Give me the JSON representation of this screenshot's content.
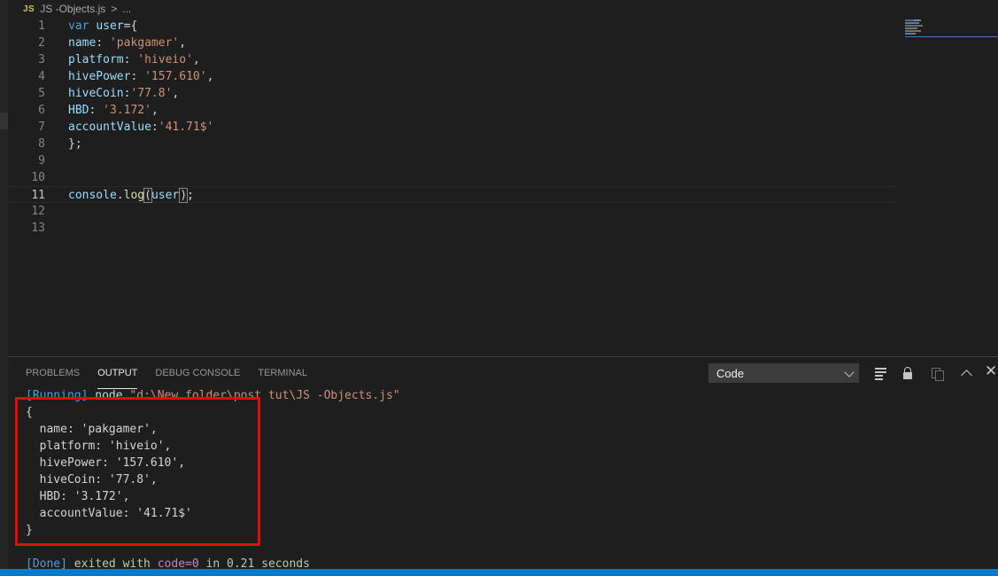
{
  "breadcrumb": {
    "file_icon": "JS",
    "file": "JS -Objects.js",
    "separator": ">",
    "trail": "..."
  },
  "editor": {
    "lines": [
      {
        "n": "1",
        "parts": [
          {
            "t": "var",
            "c": "t-var"
          },
          {
            "t": " ",
            "c": "t-plain"
          },
          {
            "t": "user",
            "c": "t-id"
          },
          {
            "t": "={",
            "c": "t-plain"
          }
        ]
      },
      {
        "n": "2",
        "parts": [
          {
            "t": "name",
            "c": "t-id"
          },
          {
            "t": ": ",
            "c": "t-plain"
          },
          {
            "t": "'pakgamer'",
            "c": "t-str"
          },
          {
            "t": ",",
            "c": "t-plain"
          }
        ]
      },
      {
        "n": "3",
        "parts": [
          {
            "t": "platform",
            "c": "t-id"
          },
          {
            "t": ": ",
            "c": "t-plain"
          },
          {
            "t": "'hiveio'",
            "c": "t-str"
          },
          {
            "t": ",",
            "c": "t-plain"
          }
        ]
      },
      {
        "n": "4",
        "parts": [
          {
            "t": "hivePower",
            "c": "t-id"
          },
          {
            "t": ": ",
            "c": "t-plain"
          },
          {
            "t": "'157.610'",
            "c": "t-str"
          },
          {
            "t": ",",
            "c": "t-plain"
          }
        ]
      },
      {
        "n": "5",
        "parts": [
          {
            "t": "hiveCoin",
            "c": "t-id"
          },
          {
            "t": ":",
            "c": "t-plain"
          },
          {
            "t": "'77.8'",
            "c": "t-str"
          },
          {
            "t": ",",
            "c": "t-plain"
          }
        ]
      },
      {
        "n": "6",
        "parts": [
          {
            "t": "HBD",
            "c": "t-id"
          },
          {
            "t": ": ",
            "c": "t-plain"
          },
          {
            "t": "'3.172'",
            "c": "t-str"
          },
          {
            "t": ",",
            "c": "t-plain"
          }
        ]
      },
      {
        "n": "7",
        "parts": [
          {
            "t": "accountValue",
            "c": "t-id"
          },
          {
            "t": ":",
            "c": "t-plain"
          },
          {
            "t": "'41.71$'",
            "c": "t-str"
          }
        ]
      },
      {
        "n": "8",
        "parts": [
          {
            "t": "};",
            "c": "t-plain"
          }
        ]
      },
      {
        "n": "9",
        "parts": []
      },
      {
        "n": "10",
        "parts": []
      },
      {
        "n": "11",
        "active": true,
        "parts": [
          {
            "t": "console",
            "c": "t-id"
          },
          {
            "t": ".",
            "c": "t-plain"
          },
          {
            "t": "log",
            "c": "t-fn"
          },
          {
            "t": "(",
            "c": "t-plain bracket-box"
          },
          {
            "t": "user",
            "c": "t-id"
          },
          {
            "t": "|",
            "c": "cursor"
          },
          {
            "t": ")",
            "c": "t-plain bracket-box"
          },
          {
            "t": ";",
            "c": "t-plain"
          }
        ]
      },
      {
        "n": "12",
        "parts": []
      },
      {
        "n": "13",
        "parts": []
      }
    ]
  },
  "panel": {
    "tabs": [
      {
        "label": "PROBLEMS",
        "active": false,
        "name": "tab-problems"
      },
      {
        "label": "OUTPUT",
        "active": true,
        "name": "tab-output"
      },
      {
        "label": "DEBUG CONSOLE",
        "active": false,
        "name": "tab-debug-console"
      },
      {
        "label": "TERMINAL",
        "active": false,
        "name": "tab-terminal"
      }
    ],
    "output_channel": "Code",
    "toolbar_icons": [
      "clear-output-icon",
      "lock-scroll-icon",
      "open-log-icon",
      "maximize-panel-icon",
      "close-panel-icon"
    ],
    "output": [
      {
        "parts": [
          {
            "t": "[Running]",
            "c": "o-blue"
          },
          {
            "t": " node ",
            "c": "o-plain"
          },
          {
            "t": "\"d:\\New folder\\post tut\\JS -Objects.js\"",
            "c": "o-str"
          }
        ]
      },
      {
        "parts": [
          {
            "t": "{",
            "c": "o-plain"
          }
        ]
      },
      {
        "parts": [
          {
            "t": "  name: ",
            "c": "o-plain"
          },
          {
            "t": "'pakgamer'",
            "c": "o-plain"
          },
          {
            "t": ",",
            "c": "o-plain"
          }
        ]
      },
      {
        "parts": [
          {
            "t": "  platform: ",
            "c": "o-plain"
          },
          {
            "t": "'hiveio'",
            "c": "o-plain"
          },
          {
            "t": ",",
            "c": "o-plain"
          }
        ]
      },
      {
        "parts": [
          {
            "t": "  hivePower: ",
            "c": "o-plain"
          },
          {
            "t": "'157.610'",
            "c": "o-plain"
          },
          {
            "t": ",",
            "c": "o-plain"
          }
        ]
      },
      {
        "parts": [
          {
            "t": "  hiveCoin: ",
            "c": "o-plain"
          },
          {
            "t": "'77.8'",
            "c": "o-plain"
          },
          {
            "t": ",",
            "c": "o-plain"
          }
        ]
      },
      {
        "parts": [
          {
            "t": "  HBD: ",
            "c": "o-plain"
          },
          {
            "t": "'3.172'",
            "c": "o-plain"
          },
          {
            "t": ",",
            "c": "o-plain"
          }
        ]
      },
      {
        "parts": [
          {
            "t": "  accountValue: ",
            "c": "o-plain"
          },
          {
            "t": "'41.71$'",
            "c": "o-plain"
          }
        ]
      },
      {
        "parts": [
          {
            "t": "}",
            "c": "o-plain"
          }
        ]
      },
      {
        "parts": []
      },
      {
        "parts": [
          {
            "t": "[Done]",
            "c": "o-blue"
          },
          {
            "t": " exited with ",
            "c": "o-green"
          },
          {
            "t": "code=0",
            "c": "o-purple"
          },
          {
            "t": " in ",
            "c": "o-green"
          },
          {
            "t": "0.21",
            "c": "o-green"
          },
          {
            "t": " seconds",
            "c": "o-green"
          }
        ]
      }
    ]
  },
  "colors": {
    "accent": "#007acc",
    "highlight_box": "#e00d0d",
    "editor_bg": "#1e1e1e"
  }
}
